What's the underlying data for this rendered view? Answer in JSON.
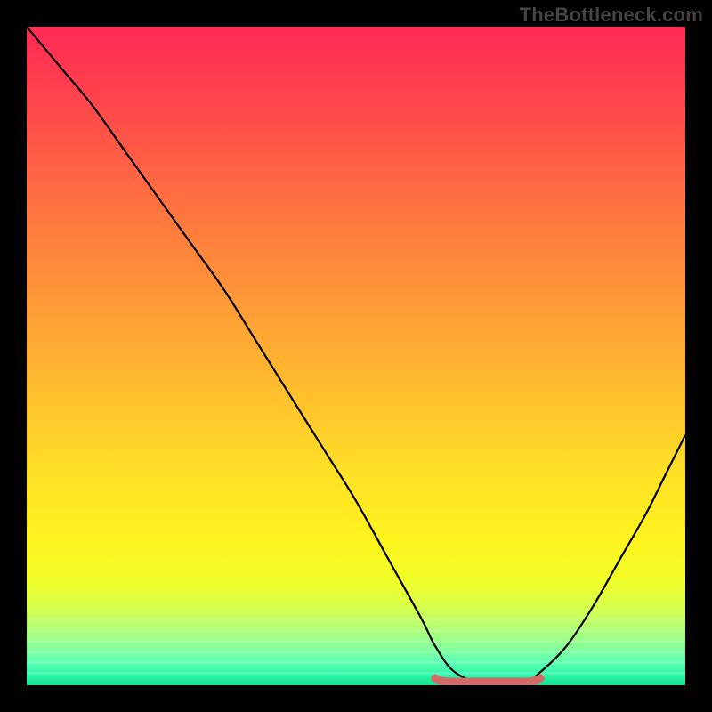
{
  "attribution": "TheBottleneck.com",
  "chart_data": {
    "type": "line",
    "title": "",
    "xlabel": "",
    "ylabel": "",
    "xlim": [
      0,
      100
    ],
    "ylim": [
      0,
      100
    ],
    "series": [
      {
        "name": "curve",
        "x": [
          0,
          5,
          10,
          15,
          20,
          25,
          30,
          35,
          40,
          45,
          50,
          55,
          60,
          62,
          65,
          70,
          75,
          78,
          82,
          86,
          90,
          94,
          97,
          100
        ],
        "values": [
          100,
          94,
          88,
          81,
          74,
          67,
          60,
          52,
          44,
          36,
          28,
          19,
          10,
          6,
          2,
          0,
          0,
          2,
          6,
          12,
          19,
          26,
          32,
          38
        ]
      }
    ],
    "trough_segment": {
      "x_start": 62,
      "x_end": 78,
      "y": 0
    },
    "background_gradient": {
      "top": "#ff2a55",
      "mid": "#ffe126",
      "bottom": "#0de08e"
    },
    "annotations": []
  }
}
